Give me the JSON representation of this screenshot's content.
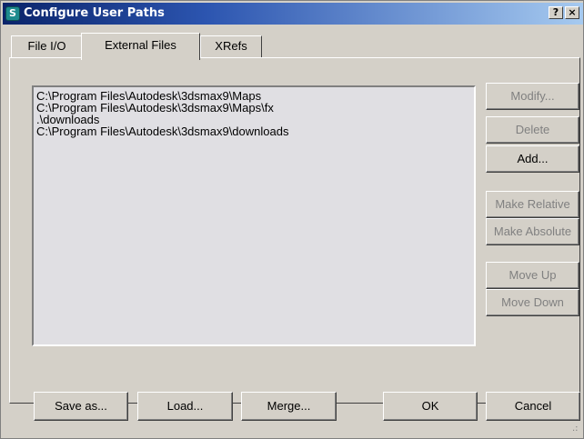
{
  "window": {
    "title": "Configure User Paths",
    "app_icon_glyph": "S",
    "help_glyph": "?",
    "close_glyph": "×"
  },
  "tabs": [
    {
      "label": "File I/O",
      "selected": false
    },
    {
      "label": "External Files",
      "selected": true
    },
    {
      "label": "XRefs",
      "selected": false
    }
  ],
  "paths": [
    "C:\\Program Files\\Autodesk\\3dsmax9\\Maps",
    "C:\\Program Files\\Autodesk\\3dsmax9\\Maps\\fx",
    ".\\downloads",
    "C:\\Program Files\\Autodesk\\3dsmax9\\downloads"
  ],
  "side_buttons": {
    "modify": {
      "label": "Modify...",
      "enabled": false
    },
    "delete": {
      "label": "Delete",
      "enabled": false
    },
    "add": {
      "label": "Add...",
      "enabled": true
    },
    "make_relative": {
      "label": "Make Relative",
      "enabled": false
    },
    "make_absolute": {
      "label": "Make Absolute",
      "enabled": false
    },
    "move_up": {
      "label": "Move Up",
      "enabled": false
    },
    "move_down": {
      "label": "Move Down",
      "enabled": false
    }
  },
  "bottom_buttons": {
    "save_as": "Save as...",
    "load": "Load...",
    "merge": "Merge...",
    "ok": "OK",
    "cancel": "Cancel"
  },
  "colors": {
    "titlebar_start": "#0a246a",
    "titlebar_end": "#a6caf0",
    "dialog_face": "#d4d0c8",
    "list_background": "#e0dfe3",
    "disabled_text": "#808080"
  }
}
